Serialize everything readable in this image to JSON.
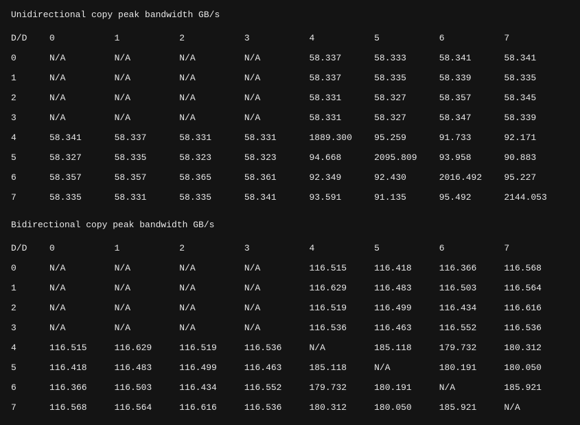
{
  "chart_data": [
    {
      "type": "table",
      "title": "Unidirectional copy peak bandwidth GB/s",
      "row_header": "D/D",
      "columns": [
        "0",
        "1",
        "2",
        "3",
        "4",
        "5",
        "6",
        "7"
      ],
      "rows": [
        {
          "label": "0",
          "values": [
            "N/A",
            "N/A",
            "N/A",
            "N/A",
            "58.337",
            "58.333",
            "58.341",
            "58.341"
          ]
        },
        {
          "label": "1",
          "values": [
            "N/A",
            "N/A",
            "N/A",
            "N/A",
            "58.337",
            "58.335",
            "58.339",
            "58.335"
          ]
        },
        {
          "label": "2",
          "values": [
            "N/A",
            "N/A",
            "N/A",
            "N/A",
            "58.331",
            "58.327",
            "58.357",
            "58.345"
          ]
        },
        {
          "label": "3",
          "values": [
            "N/A",
            "N/A",
            "N/A",
            "N/A",
            "58.331",
            "58.327",
            "58.347",
            "58.339"
          ]
        },
        {
          "label": "4",
          "values": [
            "58.341",
            "58.337",
            "58.331",
            "58.331",
            "1889.300",
            "95.259",
            "91.733",
            "92.171"
          ]
        },
        {
          "label": "5",
          "values": [
            "58.327",
            "58.335",
            "58.323",
            "58.323",
            "94.668",
            "2095.809",
            "93.958",
            "90.883"
          ]
        },
        {
          "label": "6",
          "values": [
            "58.357",
            "58.357",
            "58.365",
            "58.361",
            "92.349",
            "92.430",
            "2016.492",
            "95.227"
          ]
        },
        {
          "label": "7",
          "values": [
            "58.335",
            "58.331",
            "58.335",
            "58.341",
            "93.591",
            "91.135",
            "95.492",
            "2144.053"
          ]
        }
      ]
    },
    {
      "type": "table",
      "title": "Bidirectional copy peak bandwidth GB/s",
      "row_header": "D/D",
      "columns": [
        "0",
        "1",
        "2",
        "3",
        "4",
        "5",
        "6",
        "7"
      ],
      "rows": [
        {
          "label": "0",
          "values": [
            "N/A",
            "N/A",
            "N/A",
            "N/A",
            "116.515",
            "116.418",
            "116.366",
            "116.568"
          ]
        },
        {
          "label": "1",
          "values": [
            "N/A",
            "N/A",
            "N/A",
            "N/A",
            "116.629",
            "116.483",
            "116.503",
            "116.564"
          ]
        },
        {
          "label": "2",
          "values": [
            "N/A",
            "N/A",
            "N/A",
            "N/A",
            "116.519",
            "116.499",
            "116.434",
            "116.616"
          ]
        },
        {
          "label": "3",
          "values": [
            "N/A",
            "N/A",
            "N/A",
            "N/A",
            "116.536",
            "116.463",
            "116.552",
            "116.536"
          ]
        },
        {
          "label": "4",
          "values": [
            "116.515",
            "116.629",
            "116.519",
            "116.536",
            "N/A",
            "185.118",
            "179.732",
            "180.312"
          ]
        },
        {
          "label": "5",
          "values": [
            "116.418",
            "116.483",
            "116.499",
            "116.463",
            "185.118",
            "N/A",
            "180.191",
            "180.050"
          ]
        },
        {
          "label": "6",
          "values": [
            "116.366",
            "116.503",
            "116.434",
            "116.552",
            "179.732",
            "180.191",
            "N/A",
            "185.921"
          ]
        },
        {
          "label": "7",
          "values": [
            "116.568",
            "116.564",
            "116.616",
            "116.536",
            "180.312",
            "180.050",
            "185.921",
            "N/A"
          ]
        }
      ]
    }
  ]
}
